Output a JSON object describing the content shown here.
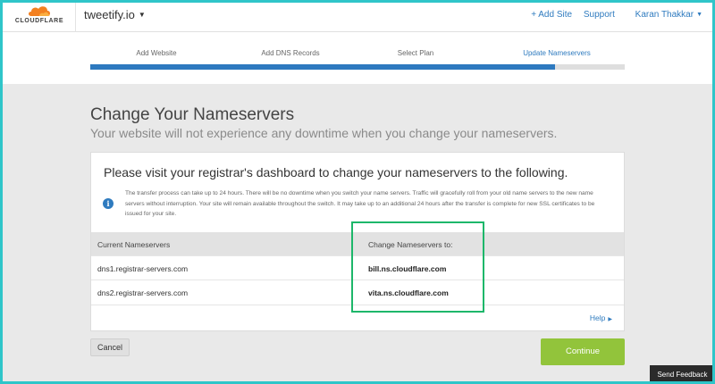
{
  "header": {
    "logo_text": "CLOUDFLARE",
    "site_name": "tweetify.io",
    "add_site": "+ Add Site",
    "support": "Support",
    "user_name": "Karan Thakkar"
  },
  "steps": {
    "items": [
      {
        "label": "Add Website"
      },
      {
        "label": "Add DNS Records"
      },
      {
        "label": "Select Plan"
      },
      {
        "label": "Update Nameservers"
      }
    ],
    "active_index": 3,
    "progress_fraction": 0.87
  },
  "page": {
    "title": "Change Your Nameservers",
    "subtitle": "Your website will not experience any downtime when you change your nameservers."
  },
  "card": {
    "heading": "Please visit your registrar's dashboard to change your nameservers to the following.",
    "info_icon": "info-icon",
    "info_text": "The transfer process can take up to 24 hours. There will be no downtime when you switch your name servers. Traffic will gracefully roll from your old name servers to the new name servers without interruption. Your site will remain available throughout the switch. It may take up to an additional 24 hours after the transfer is complete for new SSL certificates to be issued for your site.",
    "table": {
      "headers": [
        "Current Nameservers",
        "Change Nameservers to:"
      ],
      "rows": [
        [
          "dns1.registrar-servers.com",
          "bill.ns.cloudflare.com"
        ],
        [
          "dns2.registrar-servers.com",
          "vita.ns.cloudflare.com"
        ]
      ]
    },
    "help_label": "Help"
  },
  "actions": {
    "cancel": "Cancel",
    "continue": "Continue"
  },
  "feedback": "Send Feedback",
  "colors": {
    "accent": "#2d79bf",
    "continue": "#92c43b",
    "highlight": "#1db76a",
    "logo_orange": "#f38020",
    "frame": "#2fc5c9"
  }
}
